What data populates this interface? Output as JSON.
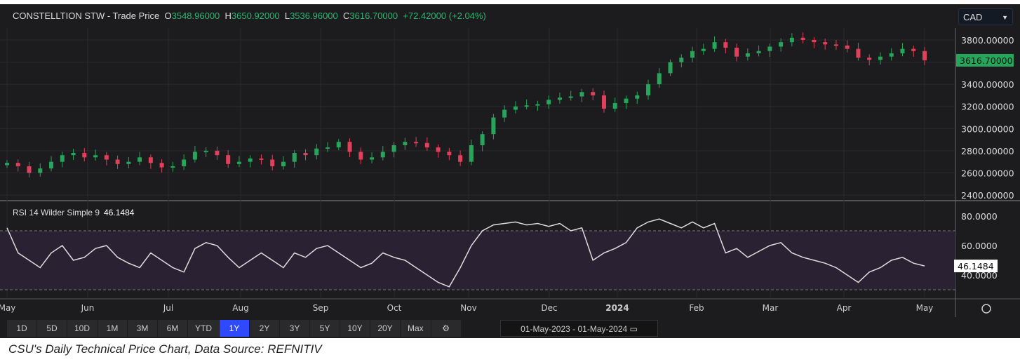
{
  "header": {
    "name": "CONSTELLTION STW - Trade Price",
    "o_label": "O",
    "open": "3548.96000",
    "h_label": "H",
    "high": "3650.92000",
    "l_label": "L",
    "low": "3536.96000",
    "c_label": "C",
    "close": "3616.70000",
    "change": "+72.42000 (+2.04%)"
  },
  "currency": {
    "value": "CAD",
    "icon": "chevron-down-icon"
  },
  "rsi": {
    "label": "RSI 14 Wilder Simple 9",
    "value": "46.1484"
  },
  "settings_icon": "gear-icon",
  "ranges": [
    "1D",
    "5D",
    "10D",
    "1M",
    "3M",
    "6M",
    "YTD",
    "1Y",
    "2Y",
    "3Y",
    "5Y",
    "10Y",
    "20Y",
    "Max"
  ],
  "active_range": "1Y",
  "date_range": "01-May-2023 - 01-May-2024",
  "caption": "CSU's Daily Technical Price Chart, Data Source: REFNITIV",
  "colors": {
    "up": "#26a65b",
    "down": "#e0405a",
    "active": "#2f49ff"
  },
  "chart_data": [
    {
      "type": "candlestick",
      "title": "CONSTELLTION STW - Trade Price",
      "ylim": [
        2350,
        3900
      ],
      "yticks": [
        "2400.00000",
        "2600.00000",
        "2800.00000",
        "3000.00000",
        "3200.00000",
        "3400.00000",
        "3600.00000",
        "3800.00000"
      ],
      "ytick_values": [
        2400,
        2600,
        2800,
        3000,
        3200,
        3400,
        3600,
        3800
      ],
      "last_price_label": "3616.70000",
      "xticks": [
        "May",
        "Jun",
        "Jul",
        "Aug",
        "Sep",
        "Oct",
        "Nov",
        "Dec",
        "2024",
        "Feb",
        "Mar",
        "Apr",
        "May"
      ],
      "closes": [
        2690,
        2660,
        2600,
        2640,
        2700,
        2760,
        2780,
        2740,
        2760,
        2720,
        2680,
        2700,
        2740,
        2690,
        2650,
        2660,
        2720,
        2790,
        2800,
        2760,
        2680,
        2700,
        2730,
        2720,
        2660,
        2700,
        2780,
        2760,
        2820,
        2830,
        2880,
        2790,
        2720,
        2740,
        2790,
        2850,
        2880,
        2870,
        2830,
        2790,
        2760,
        2700,
        2850,
        2950,
        3100,
        3170,
        3200,
        3210,
        3220,
        3260,
        3280,
        3290,
        3330,
        3300,
        3180,
        3230,
        3270,
        3300,
        3400,
        3500,
        3600,
        3640,
        3700,
        3720,
        3780,
        3730,
        3650,
        3680,
        3700,
        3740,
        3780,
        3820,
        3800,
        3780,
        3760,
        3750,
        3720,
        3640,
        3620,
        3650,
        3680,
        3720,
        3700,
        3616.7
      ]
    },
    {
      "type": "line",
      "title": "RSI 14 Wilder Simple 9",
      "ylim": [
        25,
        88
      ],
      "yticks": [
        "40.0000",
        "60.0000",
        "80.0000"
      ],
      "ytick_values": [
        40,
        60,
        80
      ],
      "bands": [
        30,
        70
      ],
      "last_value_label": "46.1484",
      "values": [
        72,
        55,
        50,
        45,
        55,
        60,
        50,
        52,
        58,
        60,
        52,
        48,
        45,
        55,
        50,
        45,
        42,
        58,
        62,
        60,
        52,
        45,
        50,
        55,
        50,
        45,
        55,
        52,
        58,
        60,
        55,
        50,
        45,
        48,
        55,
        52,
        50,
        45,
        40,
        35,
        32,
        45,
        60,
        70,
        74,
        75,
        76,
        74,
        75,
        73,
        75,
        70,
        72,
        50,
        55,
        58,
        62,
        72,
        76,
        78,
        75,
        72,
        76,
        72,
        75,
        55,
        58,
        52,
        56,
        60,
        62,
        55,
        52,
        50,
        48,
        45,
        40,
        35,
        42,
        45,
        50,
        52,
        48,
        46.15
      ]
    }
  ]
}
